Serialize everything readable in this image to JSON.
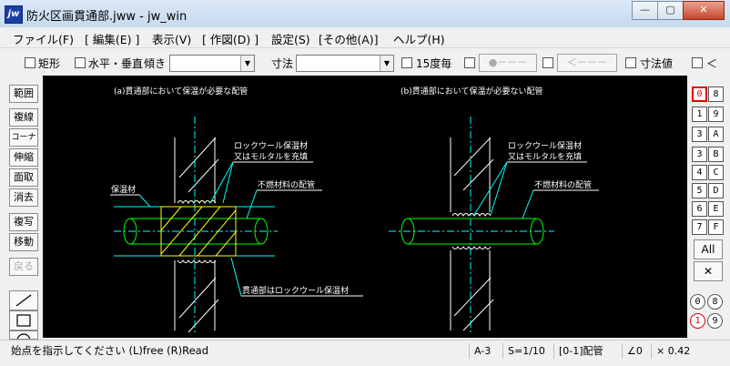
{
  "window": {
    "app_icon": "jw",
    "title": "防火区画貫通部.jww - jw_win",
    "min": "—",
    "max": "▢",
    "close": "✕"
  },
  "menu": [
    "ファイル(F)",
    "[ 編集(E) ]",
    "表示(V)",
    "[ 作図(D) ]",
    "設定(S)",
    "[その他(A)]",
    "ヘルプ(H)"
  ],
  "toolbar": {
    "rect": "矩形",
    "hv": "水平・垂直",
    "angle": "傾き",
    "dimension": "寸法",
    "deg15": "15度毎",
    "btn_dot": "●－－－",
    "btn_arrow": "＜－－－",
    "dim_value": "寸法値",
    "lt": "＜"
  },
  "left_tools": [
    "範囲",
    "複線",
    "コーナー",
    "伸縮",
    "面取",
    "消去",
    "複写",
    "移動",
    "戻る"
  ],
  "right_layers": {
    "left": [
      "0",
      "1",
      "3",
      "3",
      "4",
      "5",
      "6",
      "7"
    ],
    "right": [
      "8",
      "9",
      "A",
      "B",
      "C",
      "D",
      "E",
      "F"
    ],
    "all": "All",
    "x": "✕",
    "bottom": [
      "0",
      "1",
      "8",
      "9"
    ]
  },
  "drawing": {
    "title_a": "(a)貫通部において保温が必要な配管",
    "title_b": "(b)貫通部において保温が必要ない配管",
    "rockwool_a": "ロックウール保温材",
    "mortar_a": "又はモルタルを充填",
    "rockwool_b": "ロックウール保温材",
    "mortar_b": "又はモルタルを充填",
    "insulation": "保温材",
    "nonflam_a": "不燃材料の配管",
    "nonflam_b": "不燃材料の配管",
    "penetration": "貫通部はロックウール保温材"
  },
  "status": {
    "message": "始点を指示してください (L)free (R)Read",
    "paper": "A-3",
    "scale": "S=1/10",
    "layer": "[0-1]配管",
    "angle": "∠0",
    "zoom": "× 0.42"
  },
  "colors": {
    "cyan": "#00ffff",
    "green": "#00ff00",
    "yellow": "#ffff00",
    "white": "#ffffff"
  }
}
